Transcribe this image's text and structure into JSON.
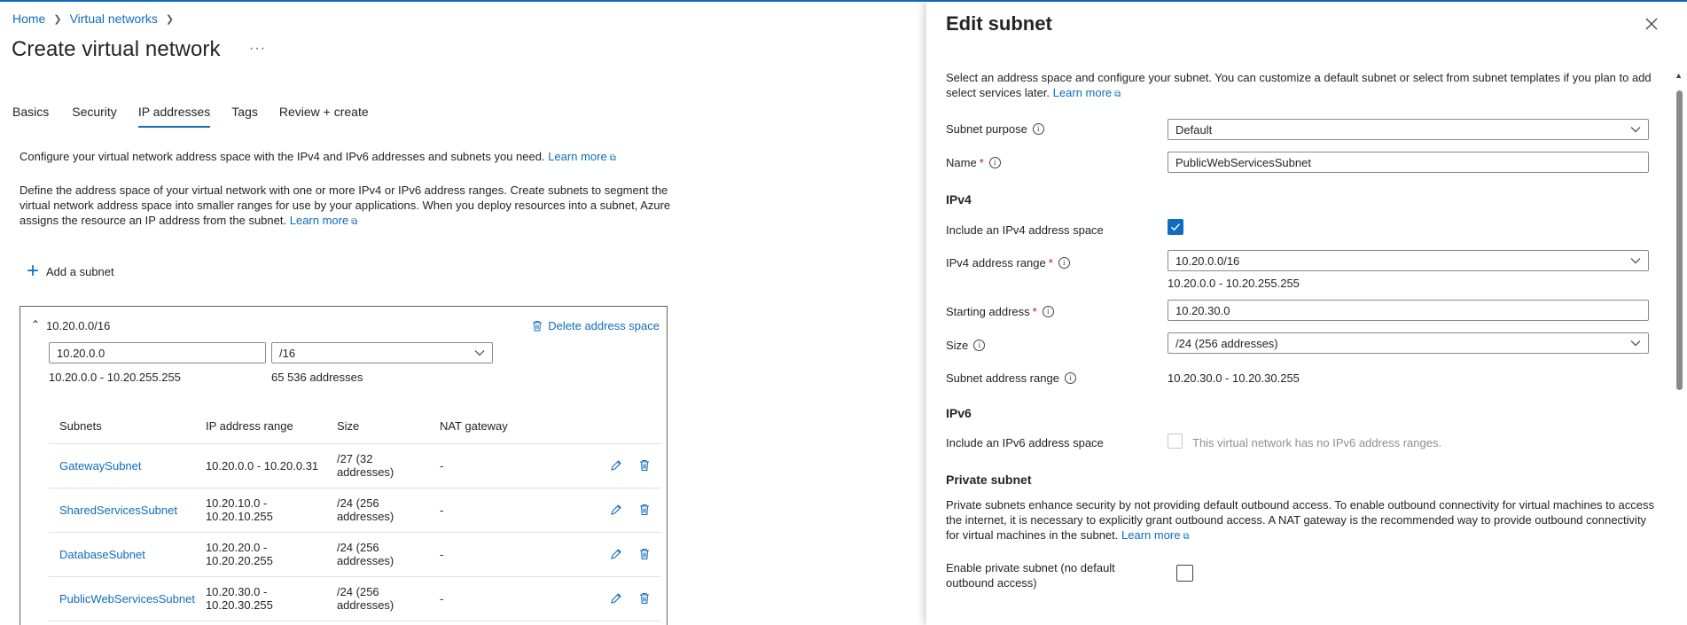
{
  "breadcrumb": {
    "home": "Home",
    "virtual_networks": "Virtual networks"
  },
  "page": {
    "title": "Create virtual network",
    "more": "···"
  },
  "tabs": [
    {
      "label": "Basics"
    },
    {
      "label": "Security"
    },
    {
      "label": "IP addresses",
      "active": true
    },
    {
      "label": "Tags"
    },
    {
      "label": "Review + create"
    }
  ],
  "intro": {
    "line1": "Configure your virtual network address space with the IPv4 and IPv6 addresses and subnets you need.",
    "line1_link": "Learn more",
    "line2": "Define the address space of your virtual network with one or more IPv4 or IPv6 address ranges. Create subnets to segment the virtual network address space into smaller ranges for use by your applications. When you deploy resources into a subnet, Azure assigns the resource an IP address from the subnet.",
    "line2_link": "Learn more"
  },
  "add_subnet_label": "Add a subnet",
  "address_space": {
    "header": "10.20.0.0/16",
    "delete_label": "Delete address space",
    "address_value": "10.20.0.0",
    "prefix_value": "/16",
    "range_text": "10.20.0.0 - 10.20.255.255",
    "count_text": "65 536 addresses",
    "columns": {
      "subnets": "Subnets",
      "range": "IP address range",
      "size": "Size",
      "nat": "NAT gateway"
    },
    "rows": [
      {
        "name": "GatewaySubnet",
        "range": "10.20.0.0 - 10.20.0.31",
        "size": "/27 (32 addresses)",
        "nat": "-"
      },
      {
        "name": "SharedServicesSubnet",
        "range": "10.20.10.0 - 10.20.10.255",
        "size": "/24 (256 addresses)",
        "nat": "-"
      },
      {
        "name": "DatabaseSubnet",
        "range": "10.20.20.0 - 10.20.20.255",
        "size": "/24 (256 addresses)",
        "nat": "-"
      },
      {
        "name": "PublicWebServicesSubnet",
        "range": "10.20.30.0 - 10.20.30.255",
        "size": "/24 (256 addresses)",
        "nat": "-"
      }
    ]
  },
  "panel": {
    "title": "Edit subnet",
    "description": "Select an address space and configure your subnet. You can customize a default subnet or select from subnet templates if you plan to add select services later.",
    "description_link": "Learn more",
    "subnet_purpose_label": "Subnet purpose",
    "subnet_purpose_value": "Default",
    "name_label": "Name",
    "name_value": "PublicWebServicesSubnet",
    "ipv4_heading": "IPv4",
    "include_ipv4_label": "Include an IPv4 address space",
    "ipv4_range_label": "IPv4 address range",
    "ipv4_range_value": "10.20.0.0/16",
    "ipv4_range_text": "10.20.0.0 - 10.20.255.255",
    "starting_address_label": "Starting address",
    "starting_address_value": "10.20.30.0",
    "size_label": "Size",
    "size_value": "/24 (256 addresses)",
    "subnet_range_label": "Subnet address range",
    "subnet_range_value": "10.20.30.0 - 10.20.30.255",
    "ipv6_heading": "IPv6",
    "include_ipv6_label": "Include an IPv6 address space",
    "ipv6_disabled_text": "This virtual network has no IPv6 address ranges.",
    "private_heading": "Private subnet",
    "private_desc": "Private subnets enhance security by not providing default outbound access. To enable outbound connectivity for virtual machines to access the internet, it is necessary to explicitly grant outbound access. A NAT gateway is the recommended way to provide outbound connectivity for virtual machines in the subnet.",
    "private_link": "Learn more",
    "enable_private_line1": "Enable private subnet (no default",
    "enable_private_line2": "outbound access)",
    "required_mark": "*",
    "info_glyph": "i"
  },
  "colors": {
    "accent": "#0f6cbd",
    "required": "#c50f1f"
  }
}
